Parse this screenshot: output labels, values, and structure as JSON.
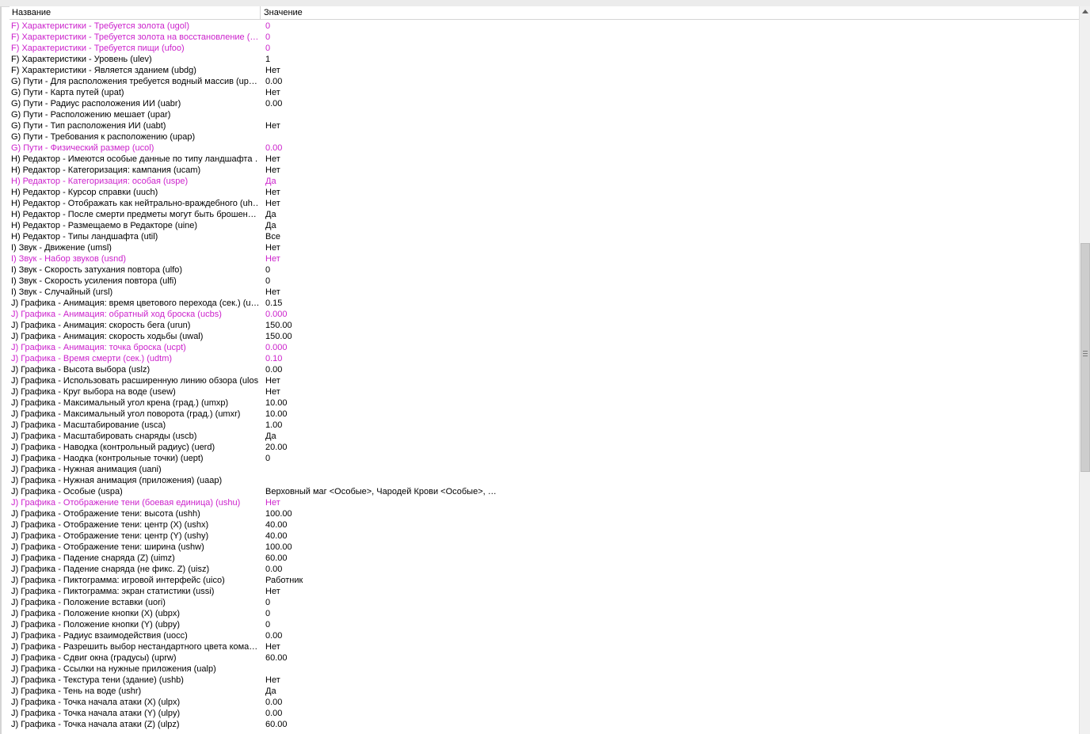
{
  "columns": {
    "name": "Название",
    "value": "Значение"
  },
  "rows": [
    {
      "name": "F) Характеристики - Требуется золота (ugol)",
      "value": "0",
      "highlight": true
    },
    {
      "name": "F) Характеристики - Требуется золота на восстановление (…",
      "value": "0",
      "highlight": true
    },
    {
      "name": "F) Характеристики - Требуется пищи (ufoo)",
      "value": "0",
      "highlight": true
    },
    {
      "name": "F) Характеристики - Уровень (ulev)",
      "value": "1",
      "highlight": false
    },
    {
      "name": "F) Характеристики - Является зданием (ubdg)",
      "value": "Нет",
      "highlight": false
    },
    {
      "name": "G) Пути - Для расположения требуется водный массив (up…",
      "value": "0.00",
      "highlight": false
    },
    {
      "name": "G) Пути - Карта путей (upat)",
      "value": "Нет",
      "highlight": false
    },
    {
      "name": "G) Пути - Радиус расположения ИИ (uabr)",
      "value": "0.00",
      "highlight": false
    },
    {
      "name": "G) Пути - Расположению мешает (upar)",
      "value": "",
      "highlight": false
    },
    {
      "name": "G) Пути - Тип расположения ИИ (uabt)",
      "value": "Нет",
      "highlight": false
    },
    {
      "name": "G) Пути - Требования к расположению (upap)",
      "value": "",
      "highlight": false
    },
    {
      "name": "G) Пути - Физический размер (ucol)",
      "value": "0.00",
      "highlight": true
    },
    {
      "name": "H) Редактор - Имеются особые данные по типу ландшафта …",
      "value": "Нет",
      "highlight": false
    },
    {
      "name": "H) Редактор - Категоризация: кампания (ucam)",
      "value": "Нет",
      "highlight": false
    },
    {
      "name": "H) Редактор - Категоризация: особая (uspe)",
      "value": "Да",
      "highlight": true
    },
    {
      "name": "H) Редактор - Курсор справки (uuch)",
      "value": "Нет",
      "highlight": false
    },
    {
      "name": "H) Редактор - Отображать как нейтрально-враждебного (uh…",
      "value": "Нет",
      "highlight": false
    },
    {
      "name": "H) Редактор - После смерти предметы могут быть брошен…",
      "value": "Да",
      "highlight": false
    },
    {
      "name": "H) Редактор - Размещаемо в Редакторе (uine)",
      "value": "Да",
      "highlight": false
    },
    {
      "name": "H) Редактор - Типы ландшафта (util)",
      "value": "Все",
      "highlight": false
    },
    {
      "name": "I) Звук - Движение (umsl)",
      "value": "Нет",
      "highlight": false
    },
    {
      "name": "I) Звук - Набор звуков (usnd)",
      "value": "Нет",
      "highlight": true
    },
    {
      "name": "I) Звук - Скорость затухания повтора (ulfo)",
      "value": "0",
      "highlight": false
    },
    {
      "name": "I) Звук - Скорость усиления повтора (ulfi)",
      "value": "0",
      "highlight": false
    },
    {
      "name": "I) Звук - Случайный (ursl)",
      "value": "Нет",
      "highlight": false
    },
    {
      "name": "J) Графика - Анимация: время цветового перехода (сек.) (u…",
      "value": "0.15",
      "highlight": false
    },
    {
      "name": "J) Графика - Анимация: обратный ход броска (ucbs)",
      "value": "0.000",
      "highlight": true
    },
    {
      "name": "J) Графика - Анимация: скорость бега (urun)",
      "value": "150.00",
      "highlight": false
    },
    {
      "name": "J) Графика - Анимация: скорость ходьбы (uwal)",
      "value": "150.00",
      "highlight": false
    },
    {
      "name": "J) Графика - Анимация: точка броска (ucpt)",
      "value": "0.000",
      "highlight": true
    },
    {
      "name": "J) Графика - Время смерти (сек.) (udtm)",
      "value": "0.10",
      "highlight": true
    },
    {
      "name": "J) Графика - Высота выбора (uslz)",
      "value": "0.00",
      "highlight": false
    },
    {
      "name": "J) Графика - Использовать расширенную линию обзора (ulos)",
      "value": "Нет",
      "highlight": false
    },
    {
      "name": "J) Графика - Круг выбора на воде (usew)",
      "value": "Нет",
      "highlight": false
    },
    {
      "name": "J) Графика - Максимальный угол крена (град.) (umxp)",
      "value": "10.00",
      "highlight": false
    },
    {
      "name": "J) Графика - Максимальный угол поворота (град.) (umxr)",
      "value": "10.00",
      "highlight": false
    },
    {
      "name": "J) Графика - Масштабирование (usca)",
      "value": "1.00",
      "highlight": false
    },
    {
      "name": "J) Графика - Масштабировать снаряды (uscb)",
      "value": "Да",
      "highlight": false
    },
    {
      "name": "J) Графика - Наводка (контрольный радиус) (uerd)",
      "value": "20.00",
      "highlight": false
    },
    {
      "name": "J) Графика - Наодка (контрольные точки) (uept)",
      "value": "0",
      "highlight": false
    },
    {
      "name": "J) Графика - Нужная анимация (uani)",
      "value": "",
      "highlight": false
    },
    {
      "name": "J) Графика - Нужная анимация (приложения) (uaap)",
      "value": "",
      "highlight": false
    },
    {
      "name": "J) Графика - Особые (uspa)",
      "value": "Верховный маг <Особые>, Чародей Крови <Особые>, …",
      "highlight": false
    },
    {
      "name": "J) Графика - Отображение тени (боевая единица) (ushu)",
      "value": "Нет",
      "highlight": true
    },
    {
      "name": "J) Графика - Отображение тени: высота (ushh)",
      "value": "100.00",
      "highlight": false
    },
    {
      "name": "J) Графика - Отображение тени: центр (X) (ushx)",
      "value": "40.00",
      "highlight": false
    },
    {
      "name": "J) Графика - Отображение тени: центр (Y) (ushy)",
      "value": "40.00",
      "highlight": false
    },
    {
      "name": "J) Графика - Отображение тени: ширина (ushw)",
      "value": "100.00",
      "highlight": false
    },
    {
      "name": "J) Графика - Падение снаряда (Z) (uimz)",
      "value": "60.00",
      "highlight": false
    },
    {
      "name": "J) Графика - Падение снаряда (не фикс. Z) (uisz)",
      "value": "0.00",
      "highlight": false
    },
    {
      "name": "J) Графика - Пиктограмма: игровой интерфейс (uico)",
      "value": "Работник",
      "highlight": false
    },
    {
      "name": "J) Графика - Пиктограмма: экран статистики (ussi)",
      "value": "Нет",
      "highlight": false
    },
    {
      "name": "J) Графика - Положение вставки (uori)",
      "value": "0",
      "highlight": false
    },
    {
      "name": "J) Графика - Положение кнопки (X) (ubpx)",
      "value": "0",
      "highlight": false
    },
    {
      "name": "J) Графика - Положение кнопки (Y) (ubpy)",
      "value": "0",
      "highlight": false
    },
    {
      "name": "J) Графика - Радиус взаимодействия (uocc)",
      "value": "0.00",
      "highlight": false
    },
    {
      "name": "J) Графика - Разрешить выбор нестандартного цвета кома…",
      "value": "Нет",
      "highlight": false
    },
    {
      "name": "J) Графика - Сдвиг окна (градусы) (uprw)",
      "value": "60.00",
      "highlight": false
    },
    {
      "name": "J) Графика - Ссылки на нужные приложения (ualp)",
      "value": "",
      "highlight": false
    },
    {
      "name": "J) Графика - Текстура тени (здание) (ushb)",
      "value": "Нет",
      "highlight": false
    },
    {
      "name": "J) Графика - Тень на воде (ushr)",
      "value": "Да",
      "highlight": false
    },
    {
      "name": "J) Графика - Точка начала атаки (X) (ulpx)",
      "value": "0.00",
      "highlight": false
    },
    {
      "name": "J) Графика - Точка начала атаки (Y) (ulpy)",
      "value": "0.00",
      "highlight": false
    },
    {
      "name": "J) Графика - Точка начала атаки (Z) (ulpz)",
      "value": "60.00",
      "highlight": false
    }
  ],
  "colors": {
    "highlight": "#cc22cc",
    "text": "#000000",
    "scrollbar_thumb": "#cdcdcd"
  },
  "scrollbar": {
    "thumb_icon": "grip-icon"
  }
}
